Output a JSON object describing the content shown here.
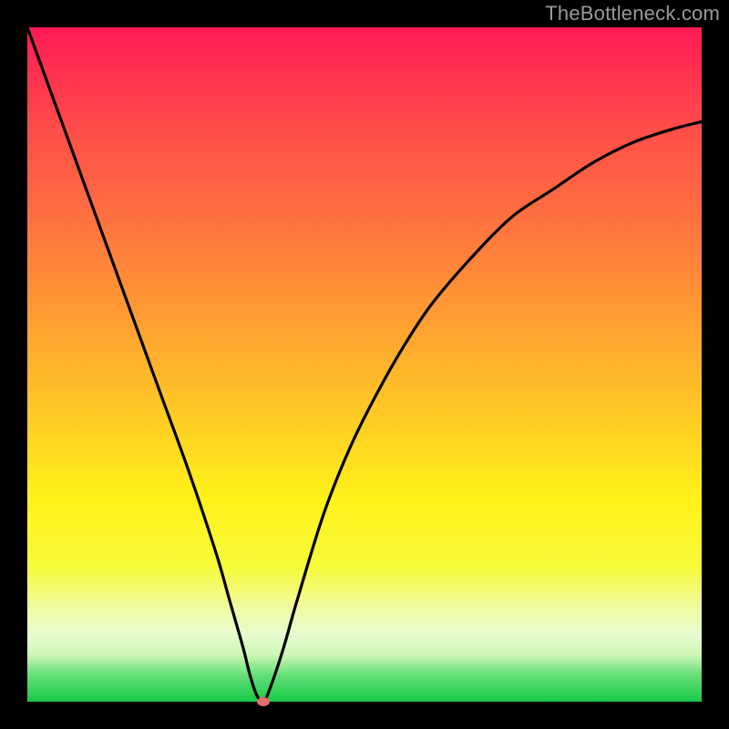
{
  "watermark": {
    "text": "TheBottleneck.com"
  },
  "chart_data": {
    "type": "line",
    "title": "",
    "xlabel": "",
    "ylabel": "",
    "xlim": [
      0,
      100
    ],
    "ylim": [
      0,
      100
    ],
    "grid": false,
    "curve": {
      "name": "bottleneck-curve",
      "x": [
        0,
        4,
        8,
        12,
        16,
        20,
        24,
        28,
        30,
        32,
        33,
        34,
        35,
        36,
        38,
        40,
        44,
        48,
        52,
        56,
        60,
        66,
        72,
        78,
        84,
        90,
        96,
        100
      ],
      "y": [
        100,
        89,
        78,
        67,
        56,
        45,
        34,
        22,
        15,
        8,
        4,
        1,
        0,
        2,
        8,
        15,
        28,
        38,
        46,
        53,
        59,
        66,
        72,
        76,
        80,
        83,
        85,
        86
      ]
    },
    "marker": {
      "x": 35,
      "y": 0,
      "color": "#e46d6d"
    },
    "background_gradient": {
      "top": "#ff1a55",
      "mid": "#fff11a",
      "bottom": "#18c94a"
    }
  }
}
